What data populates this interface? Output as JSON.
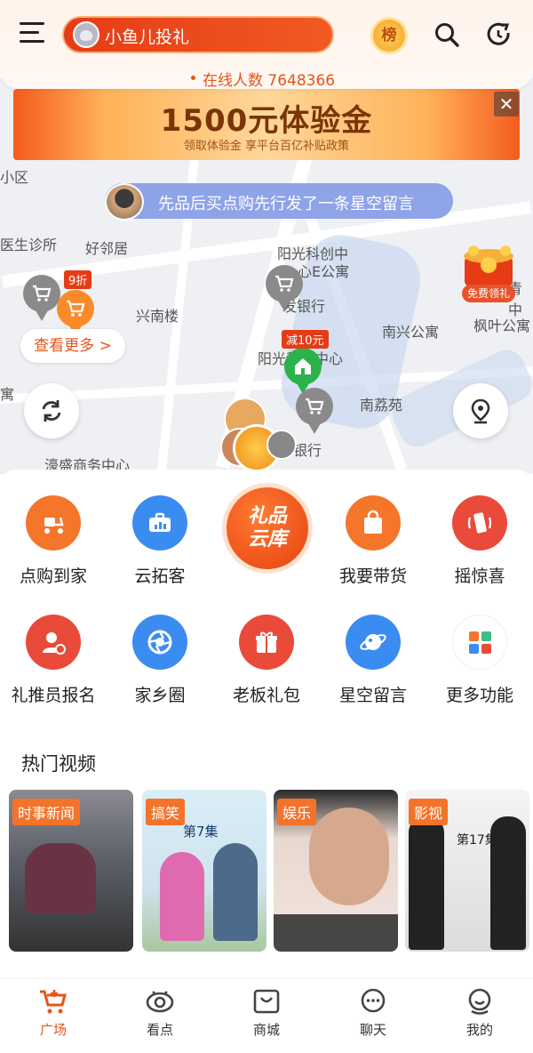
{
  "header": {
    "title": "小鱼儿投礼",
    "rank_label": "榜",
    "online_label": "在线人数 7648366"
  },
  "banner": {
    "title": "1500元体验金",
    "subtitle": "领取体验金  享平台百亿补贴政策",
    "close": "✕"
  },
  "message": {
    "text": "先品后买点购先行发了一条星空留言"
  },
  "map": {
    "labels": [
      "小区",
      "医生诊所",
      "好邻居",
      "阳光科创中",
      "心E公寓",
      "兴南楼",
      "发银行",
      "南兴公寓",
      "枫叶公寓",
      "阳光科创中心",
      "南荔苑",
      "濠盛商务中心",
      "银行",
      "寓",
      "青中"
    ],
    "tag_discount": "9折",
    "tag_reduce": "减10元",
    "more_button": "查看更多 >",
    "free_gift": "免费领礼"
  },
  "grid": {
    "row1": [
      {
        "label": "点购到家",
        "color": "#f5762a"
      },
      {
        "label": "云拓客",
        "color": "#3b8cf0"
      },
      {
        "label": "",
        "color": "#e6420f"
      },
      {
        "label": "我要带货",
        "color": "#f5762a"
      },
      {
        "label": "摇惊喜",
        "color": "#ea4a3a"
      }
    ],
    "row2": [
      {
        "label": "礼推员报名",
        "color": "#ea4a3a"
      },
      {
        "label": "家乡圈",
        "color": "#3b8cf0"
      },
      {
        "label": "老板礼包",
        "color": "#ea4a3a"
      },
      {
        "label": "星空留言",
        "color": "#3b8cf0"
      },
      {
        "label": "更多功能",
        "color": "#ffffff"
      }
    ],
    "center_badge": "礼品\n云库"
  },
  "hot": {
    "title": "热门视频",
    "videos": [
      {
        "tag": "时事新闻"
      },
      {
        "tag": "搞笑",
        "caption": "第7集"
      },
      {
        "tag": "娱乐"
      },
      {
        "tag": "影视",
        "caption": "第17集"
      }
    ]
  },
  "tabs": [
    {
      "label": "广场",
      "active": true
    },
    {
      "label": "看点"
    },
    {
      "label": "商城"
    },
    {
      "label": "聊天"
    },
    {
      "label": "我的"
    }
  ],
  "colors": {
    "accent": "#e65418",
    "blue": "#3b8cf0"
  }
}
